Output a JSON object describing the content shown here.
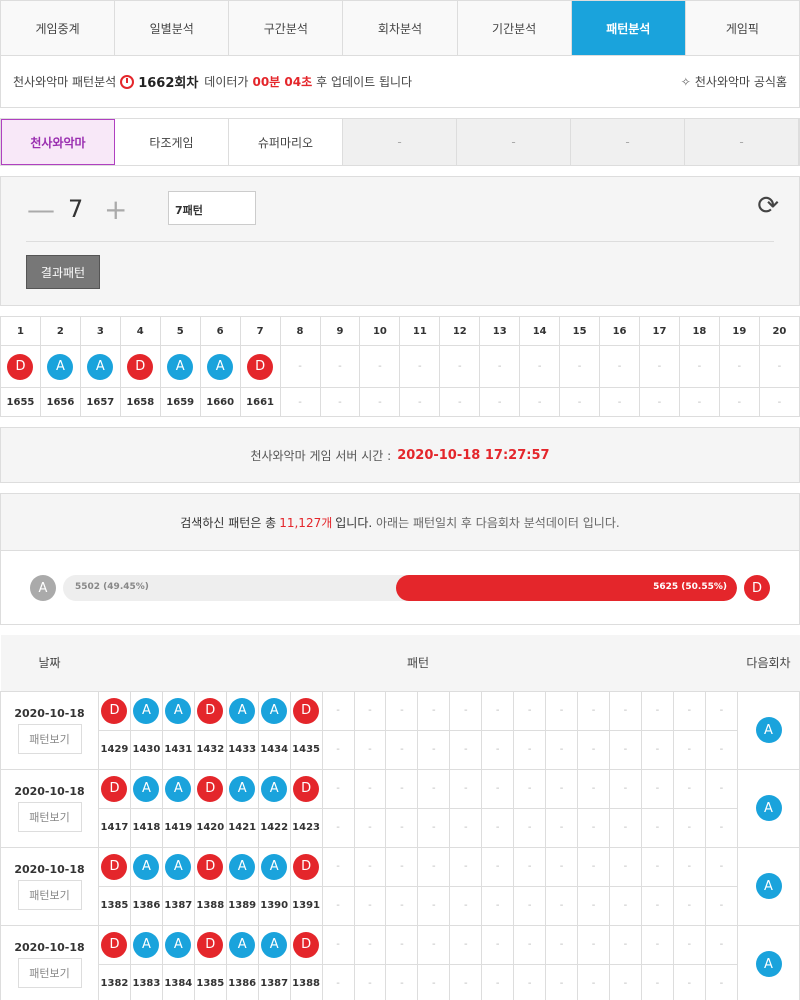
{
  "tabs": [
    "게임중계",
    "일별분석",
    "구간분석",
    "회차분석",
    "기간분석",
    "패턴분석",
    "게임픽"
  ],
  "info": {
    "label": "천사와악마 패턴분석",
    "round": "1662회차",
    "pre": "데이터가",
    "time": "00분 04초",
    "post": "후 업데이트 됩니다",
    "home": "천사와악마 공식홈"
  },
  "games": [
    "천사와악마",
    "타조게임",
    "슈퍼마리오",
    "-",
    "-",
    "-",
    "-"
  ],
  "controls": {
    "minus": "—",
    "value": "7",
    "plus": "+",
    "select": "7패턴",
    "button": "결과패턴"
  },
  "pattern": {
    "cols": [
      "1",
      "2",
      "3",
      "4",
      "5",
      "6",
      "7",
      "8",
      "9",
      "10",
      "11",
      "12",
      "13",
      "14",
      "15",
      "16",
      "17",
      "18",
      "19",
      "20"
    ],
    "balls": [
      "D",
      "A",
      "A",
      "D",
      "A",
      "A",
      "D"
    ],
    "rounds": [
      "1655",
      "1656",
      "1657",
      "1658",
      "1659",
      "1660",
      "1661"
    ]
  },
  "server": {
    "label": "천사와악마 게임 서버 시간 :",
    "time": "2020-10-18 17:27:57"
  },
  "summary": {
    "pre": "검색하신 패턴은 총",
    "count": "11,127개",
    "mid": "입니다.",
    "post": "아래는 패턴일치 후 다음회차 분석데이터 입니다."
  },
  "ratio": {
    "a_label": "A",
    "a_text": "5502 (49.45%)",
    "a_pct": 49.45,
    "d_label": "D",
    "d_text": "5625 (50.55%)",
    "d_pct": 50.55
  },
  "results": {
    "headers": [
      "날짜",
      "패턴",
      "다음회차"
    ],
    "button": "패턴보기",
    "rows": [
      {
        "date": "2020-10-18",
        "balls": [
          "D",
          "A",
          "A",
          "D",
          "A",
          "A",
          "D"
        ],
        "rounds": [
          "1429",
          "1430",
          "1431",
          "1432",
          "1433",
          "1434",
          "1435"
        ],
        "next": "A"
      },
      {
        "date": "2020-10-18",
        "balls": [
          "D",
          "A",
          "A",
          "D",
          "A",
          "A",
          "D"
        ],
        "rounds": [
          "1417",
          "1418",
          "1419",
          "1420",
          "1421",
          "1422",
          "1423"
        ],
        "next": "A"
      },
      {
        "date": "2020-10-18",
        "balls": [
          "D",
          "A",
          "A",
          "D",
          "A",
          "A",
          "D"
        ],
        "rounds": [
          "1385",
          "1386",
          "1387",
          "1388",
          "1389",
          "1390",
          "1391"
        ],
        "next": "A"
      },
      {
        "date": "2020-10-18",
        "balls": [
          "D",
          "A",
          "A",
          "D",
          "A",
          "A",
          "D"
        ],
        "rounds": [
          "1382",
          "1383",
          "1384",
          "1385",
          "1386",
          "1387",
          "1388"
        ],
        "next": "A"
      }
    ]
  },
  "dash": "-",
  "colors": {
    "accent": "#1aa3dc",
    "red": "#e4262b",
    "purple": "#9a2fb0"
  }
}
